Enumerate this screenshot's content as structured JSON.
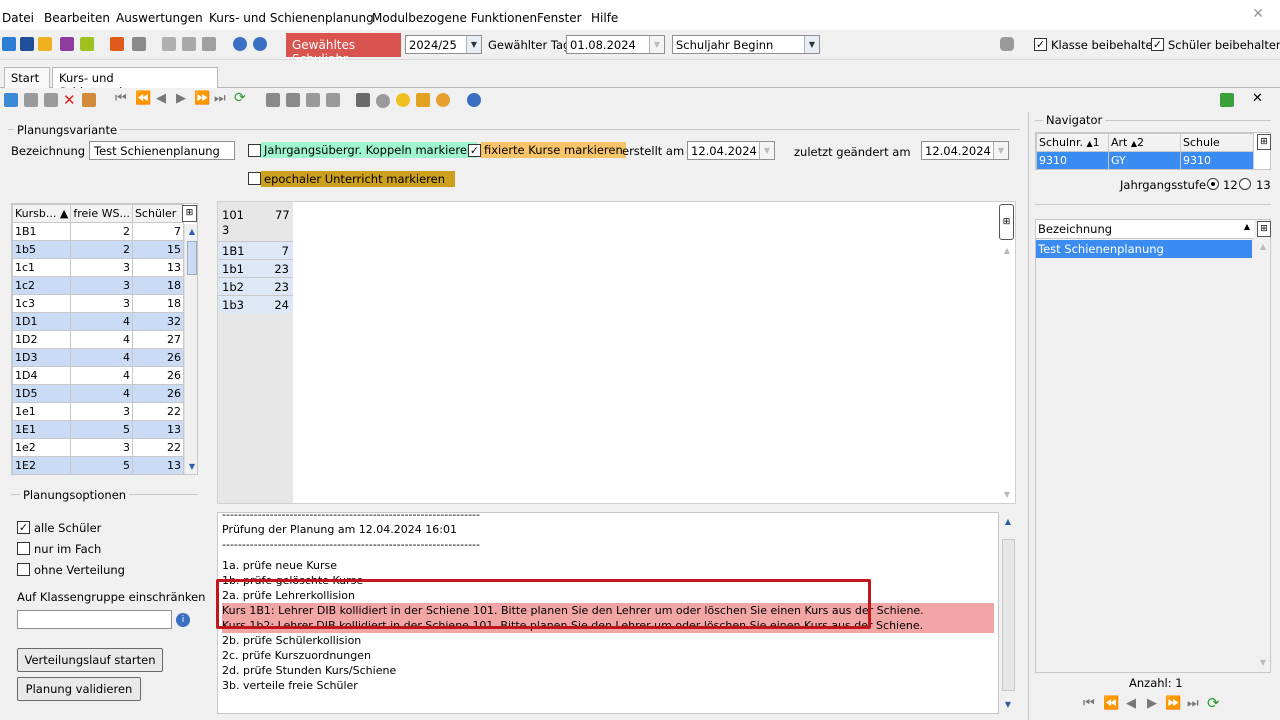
{
  "menu": [
    "Datei",
    "Bearbeiten",
    "Auswertungen",
    "Kurs- und Schienenplanung",
    "Modulbezogene Funktionen",
    "Fenster",
    "Hilfe"
  ],
  "toolbar": {
    "selected_year_label": "Gewähltes Schuljahr",
    "year_value": "2024/25",
    "day_label": "Gewählter Tag",
    "day_value": "01.08.2024",
    "period_value": "Schuljahr Beginn",
    "keep_class_label": "Klasse beibehalten",
    "keep_student_label": "Schüler beibehalten",
    "keep_class_checked": "✓",
    "keep_student_checked": "✓"
  },
  "tabs": [
    {
      "label": "Start"
    },
    {
      "label": "Kurs- und Schienenplanung"
    }
  ],
  "planning": {
    "section_title": "Planungsvariante",
    "name_label": "Bezeichnung",
    "name_value": "Test Schienenplanung",
    "cb_cross_year": "Jahrgangsübergr. Koppeln markieren",
    "cb_fixed": "fixierte Kurse markieren",
    "cb_epochal": "epochaler Unterricht markieren",
    "fixed_checked": "✓",
    "created_label": "erstellt am",
    "created_value": "12.04.2024",
    "changed_label": "zuletzt geändert am",
    "changed_value": "12.04.2024"
  },
  "course_table": {
    "headers": [
      "Kursb...",
      "freie WS...",
      "Schüler"
    ],
    "rows": [
      [
        "1B1",
        "2",
        "7"
      ],
      [
        "1b5",
        "2",
        "15"
      ],
      [
        "1c1",
        "3",
        "13"
      ],
      [
        "1c2",
        "3",
        "18"
      ],
      [
        "1c3",
        "3",
        "18"
      ],
      [
        "1D1",
        "4",
        "32"
      ],
      [
        "1D2",
        "4",
        "27"
      ],
      [
        "1D3",
        "4",
        "26"
      ],
      [
        "1D4",
        "4",
        "26"
      ],
      [
        "1D5",
        "4",
        "26"
      ],
      [
        "1e1",
        "3",
        "22"
      ],
      [
        "1E1",
        "5",
        "13"
      ],
      [
        "1e2",
        "3",
        "22"
      ],
      [
        "1E2",
        "5",
        "13"
      ]
    ]
  },
  "rail_grid": {
    "header_a": "101",
    "header_b": "77",
    "header_c": "3",
    "rows": [
      [
        "1B1",
        "7"
      ],
      [
        "1b1",
        "23"
      ],
      [
        "1b2",
        "23"
      ],
      [
        "1b3",
        "24"
      ]
    ]
  },
  "options": {
    "section_title": "Planungsoptionen",
    "all_students": "alle Schüler",
    "all_students_checked": "✓",
    "only_subject": "nur im Fach",
    "no_distribution": "ohne Verteilung",
    "restrict_label": "Auf Klassengruppe einschränken",
    "restrict_value": "",
    "btn_start": "Verteilungslauf starten",
    "btn_validate": "Planung validieren"
  },
  "log": {
    "lines": [
      {
        "text": "-----------------------------------------------------------------",
        "err": false
      },
      {
        "text": "Prüfung der Planung am 12.04.2024 16:01",
        "err": false
      },
      {
        "text": "-----------------------------------------------------------------",
        "err": false
      },
      {
        "text": "1a. prüfe neue Kurse",
        "err": false
      },
      {
        "text": "1b. prüfe gelöschte Kurse",
        "err": false
      },
      {
        "text": "2a. prüfe Lehrerkollision",
        "err": false
      },
      {
        "text": "Kurs 1B1: Lehrer DIB kollidiert in der Schiene 101. Bitte planen Sie den Lehrer um oder löschen Sie einen Kurs aus der Schiene.",
        "err": true
      },
      {
        "text": "Kurs 1b2: Lehrer DIB kollidiert in der Schiene 101. Bitte planen Sie den Lehrer um oder löschen Sie einen Kurs aus der Schiene.",
        "err": true
      },
      {
        "text": "2b. prüfe Schülerkollision",
        "err": false
      },
      {
        "text": "2c. prüfe Kurszuordnungen",
        "err": false
      },
      {
        "text": "2d. prüfe Stunden Kurs/Schiene",
        "err": false
      },
      {
        "text": "3b. verteile freie Schüler",
        "err": false
      }
    ],
    "highlight_color": "#c0161d"
  },
  "navigator": {
    "title": "Navigator",
    "school_headers": [
      "Schulnr.",
      "Art",
      "Schule"
    ],
    "sort_1": "1",
    "sort_2": "2",
    "school_row": [
      "9310",
      "GY",
      "9310"
    ],
    "grade_label": "Jahrgangsstufe",
    "grade_12": "12",
    "grade_13": "13",
    "list_header": "Bezeichnung",
    "list_item": "Test Schienenplanung",
    "count_label": "Anzahl: 1",
    "selected_color": "#3b8cf0"
  }
}
